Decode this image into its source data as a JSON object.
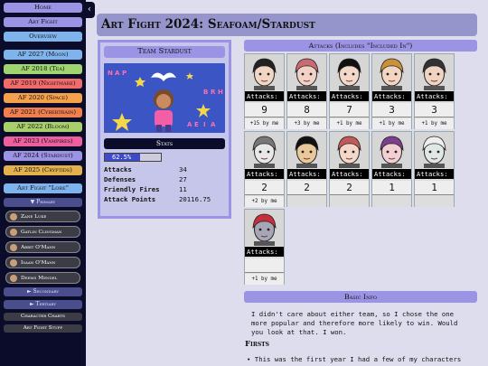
{
  "sidebar": {
    "top_buttons": [
      "Home",
      "Art Fight",
      "Overview"
    ],
    "years": [
      {
        "label": "AF 2027 (Moon)",
        "color": "#7fb3ec"
      },
      {
        "label": "AF 2018 (Tea)",
        "color": "#9fd46e"
      },
      {
        "label": "AF 2019 (Nightmare)",
        "color": "#f26b6b"
      },
      {
        "label": "AF 2020 (Space)",
        "color": "#f5a04a"
      },
      {
        "label": "AF 2021 (Cybertrain)",
        "color": "#f07f4e"
      },
      {
        "label": "AF 2022 (Bloom)",
        "color": "#a9cf6a"
      },
      {
        "label": "AF 2023 (Vampires)",
        "color": "#ee5f9e"
      },
      {
        "label": "AF 2024 (Stardust)",
        "color": "#9b93e4"
      },
      {
        "label": "AF 2025 (Cryptids)",
        "color": "#e3b24c"
      }
    ],
    "lore_button": "Art Fight \"Lore\"",
    "primary_label": "▼ Primary",
    "characters": [
      "Zane Luke",
      "Gatlin Clingman",
      "Abbit O'Mann",
      "Isaan O'Mann",
      "Deems Mendel"
    ],
    "secondary_label": "► Secondary",
    "tertiary_label": "► Tertiary",
    "bottom_buttons": [
      "Character Charts",
      "Art Fight Stuff"
    ],
    "collapse_glyph": "‹"
  },
  "page": {
    "title": "Art Fight 2024: Seafoam/Stardust"
  },
  "team": {
    "heading": "Team Stardust",
    "stats_heading": "Stats",
    "percent_label": "62.5%",
    "percent_value": 62.5,
    "stats": [
      {
        "key": "Attacks",
        "value": "34"
      },
      {
        "key": "Defenses",
        "value": "27"
      },
      {
        "key": "Friendly Fires",
        "value": "11"
      },
      {
        "key": "Attack Points",
        "value": "20116.75"
      }
    ]
  },
  "attacks": {
    "heading": "Attacks (Includes \"Included In\")",
    "label": "Attacks:",
    "cards": [
      {
        "count": "9",
        "by": "+15 by me",
        "icon": "character-portrait"
      },
      {
        "count": "8",
        "by": "+3 by me",
        "icon": "character-portrait"
      },
      {
        "count": "7",
        "by": "+1 by me",
        "icon": "character-portrait"
      },
      {
        "count": "3",
        "by": "+1 by me",
        "icon": "character-portrait"
      },
      {
        "count": "3",
        "by": "+1 by me",
        "icon": "character-portrait"
      },
      {
        "count": "2",
        "by": "+2 by me",
        "icon": "character-portrait"
      },
      {
        "count": "2",
        "by": "",
        "icon": "character-portrait"
      },
      {
        "count": "2",
        "by": "",
        "icon": "character-portrait"
      },
      {
        "count": "1",
        "by": "",
        "icon": "character-portrait"
      },
      {
        "count": "1",
        "by": "",
        "icon": "character-portrait"
      },
      {
        "count": "",
        "by": "+1 by me",
        "icon": "character-portrait"
      }
    ]
  },
  "basic_info": {
    "heading": "Basic Info",
    "text": "I didn't care about either team, so I chose the one more popular and therefore more likely to win. Would you look at that. I won.",
    "firsts_heading": "Firsts",
    "firsts_item": "This was the first year I had a few of my characters"
  }
}
